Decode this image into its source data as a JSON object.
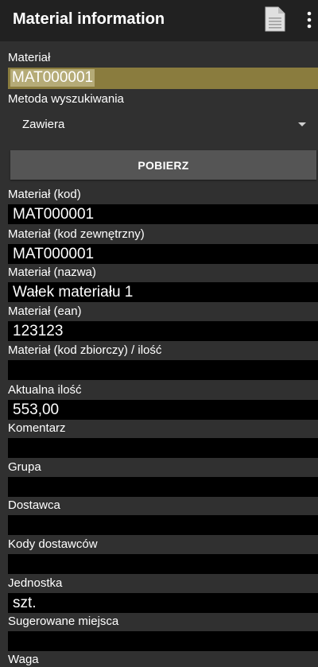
{
  "appbar": {
    "title": "Material information",
    "doc_icon": "document-icon",
    "more_icon": "more-vert-icon"
  },
  "search": {
    "material_label": "Materiał",
    "material_value": "MAT000001",
    "method_label": "Metoda wyszukiwania",
    "method_value": "Zawiera",
    "button_label": "POBIERZ"
  },
  "fields": {
    "kod_label": "Materiał (kod)",
    "kod_value": "MAT000001",
    "kod_zew_label": "Materiał (kod zewnętrzny)",
    "kod_zew_value": "MAT000001",
    "nazwa_label": "Materiał (nazwa)",
    "nazwa_value": "Wałek materiału 1",
    "ean_label": "Materiał (ean)",
    "ean_value": "123123",
    "kod_zbiorczy_label": "Materiał (kod zbiorczy) / ilość",
    "kod_zbiorczy_value": "",
    "ilosc_label": "Aktualna ilość",
    "ilosc_value": "553,00",
    "komentarz_label": "Komentarz",
    "komentarz_value": "",
    "grupa_label": "Grupa",
    "grupa_value": "",
    "dostawca_label": "Dostawca",
    "dostawca_value": "",
    "kody_dost_label": "Kody dostawców",
    "kody_dost_value": "",
    "jednostka_label": "Jednostka",
    "jednostka_value": "szt.",
    "miejsca_label": "Sugerowane miejsca",
    "miejsca_value": "",
    "waga_label": "Waga"
  },
  "colors": {
    "background": "#303030",
    "appbar": "#212121",
    "input_highlight": "#8a7c3e",
    "text_selection": "#b5ab77",
    "field_bg": "#000000",
    "button": "#555555"
  }
}
